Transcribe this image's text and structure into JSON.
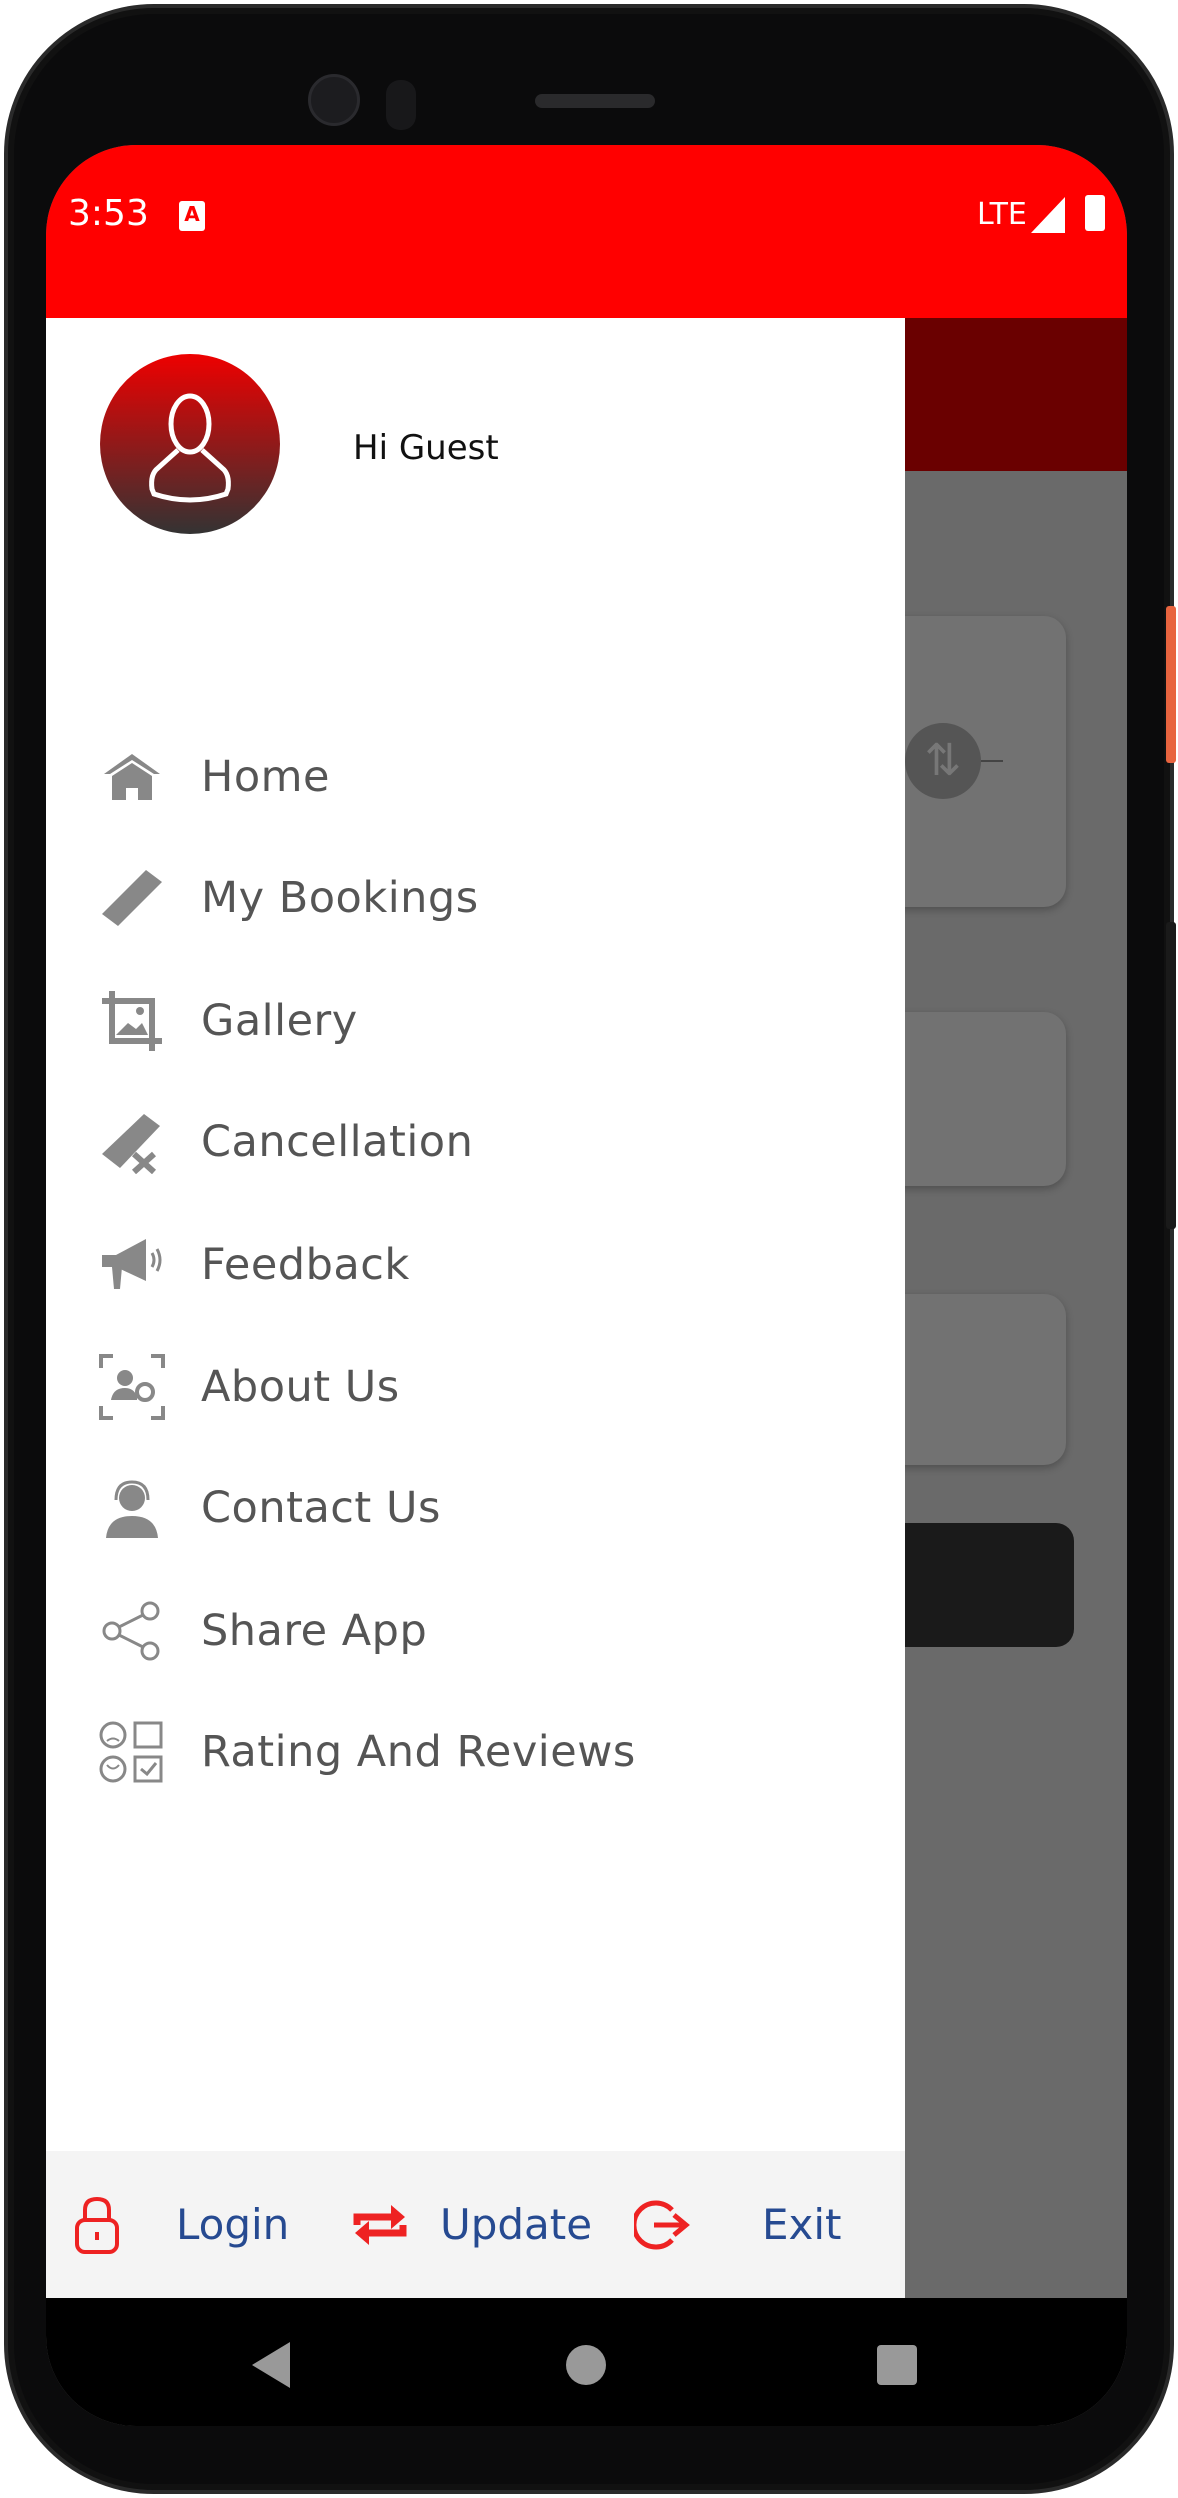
{
  "status_bar": {
    "time": "3:53",
    "network": "LTE",
    "color": "#ff0000"
  },
  "drawer": {
    "greeting": "Hi Guest",
    "items": [
      {
        "label": "Home",
        "icon": "home-icon"
      },
      {
        "label": "My Bookings",
        "icon": "ticket-icon"
      },
      {
        "label": "Gallery",
        "icon": "gallery-icon"
      },
      {
        "label": "Cancellation",
        "icon": "ticket-cancel-icon"
      },
      {
        "label": "Feedback",
        "icon": "megaphone-icon"
      },
      {
        "label": "About Us",
        "icon": "about-icon"
      },
      {
        "label": "Contact Us",
        "icon": "support-agent-icon"
      },
      {
        "label": "Share App",
        "icon": "share-icon"
      },
      {
        "label": "Rating And Reviews",
        "icon": "rating-icon"
      }
    ],
    "footer": {
      "login": "Login",
      "update": "Update",
      "exit": "Exit"
    }
  },
  "colors": {
    "accent": "#ff0000",
    "footer_text": "#264a91",
    "icon_gray": "#888888"
  }
}
